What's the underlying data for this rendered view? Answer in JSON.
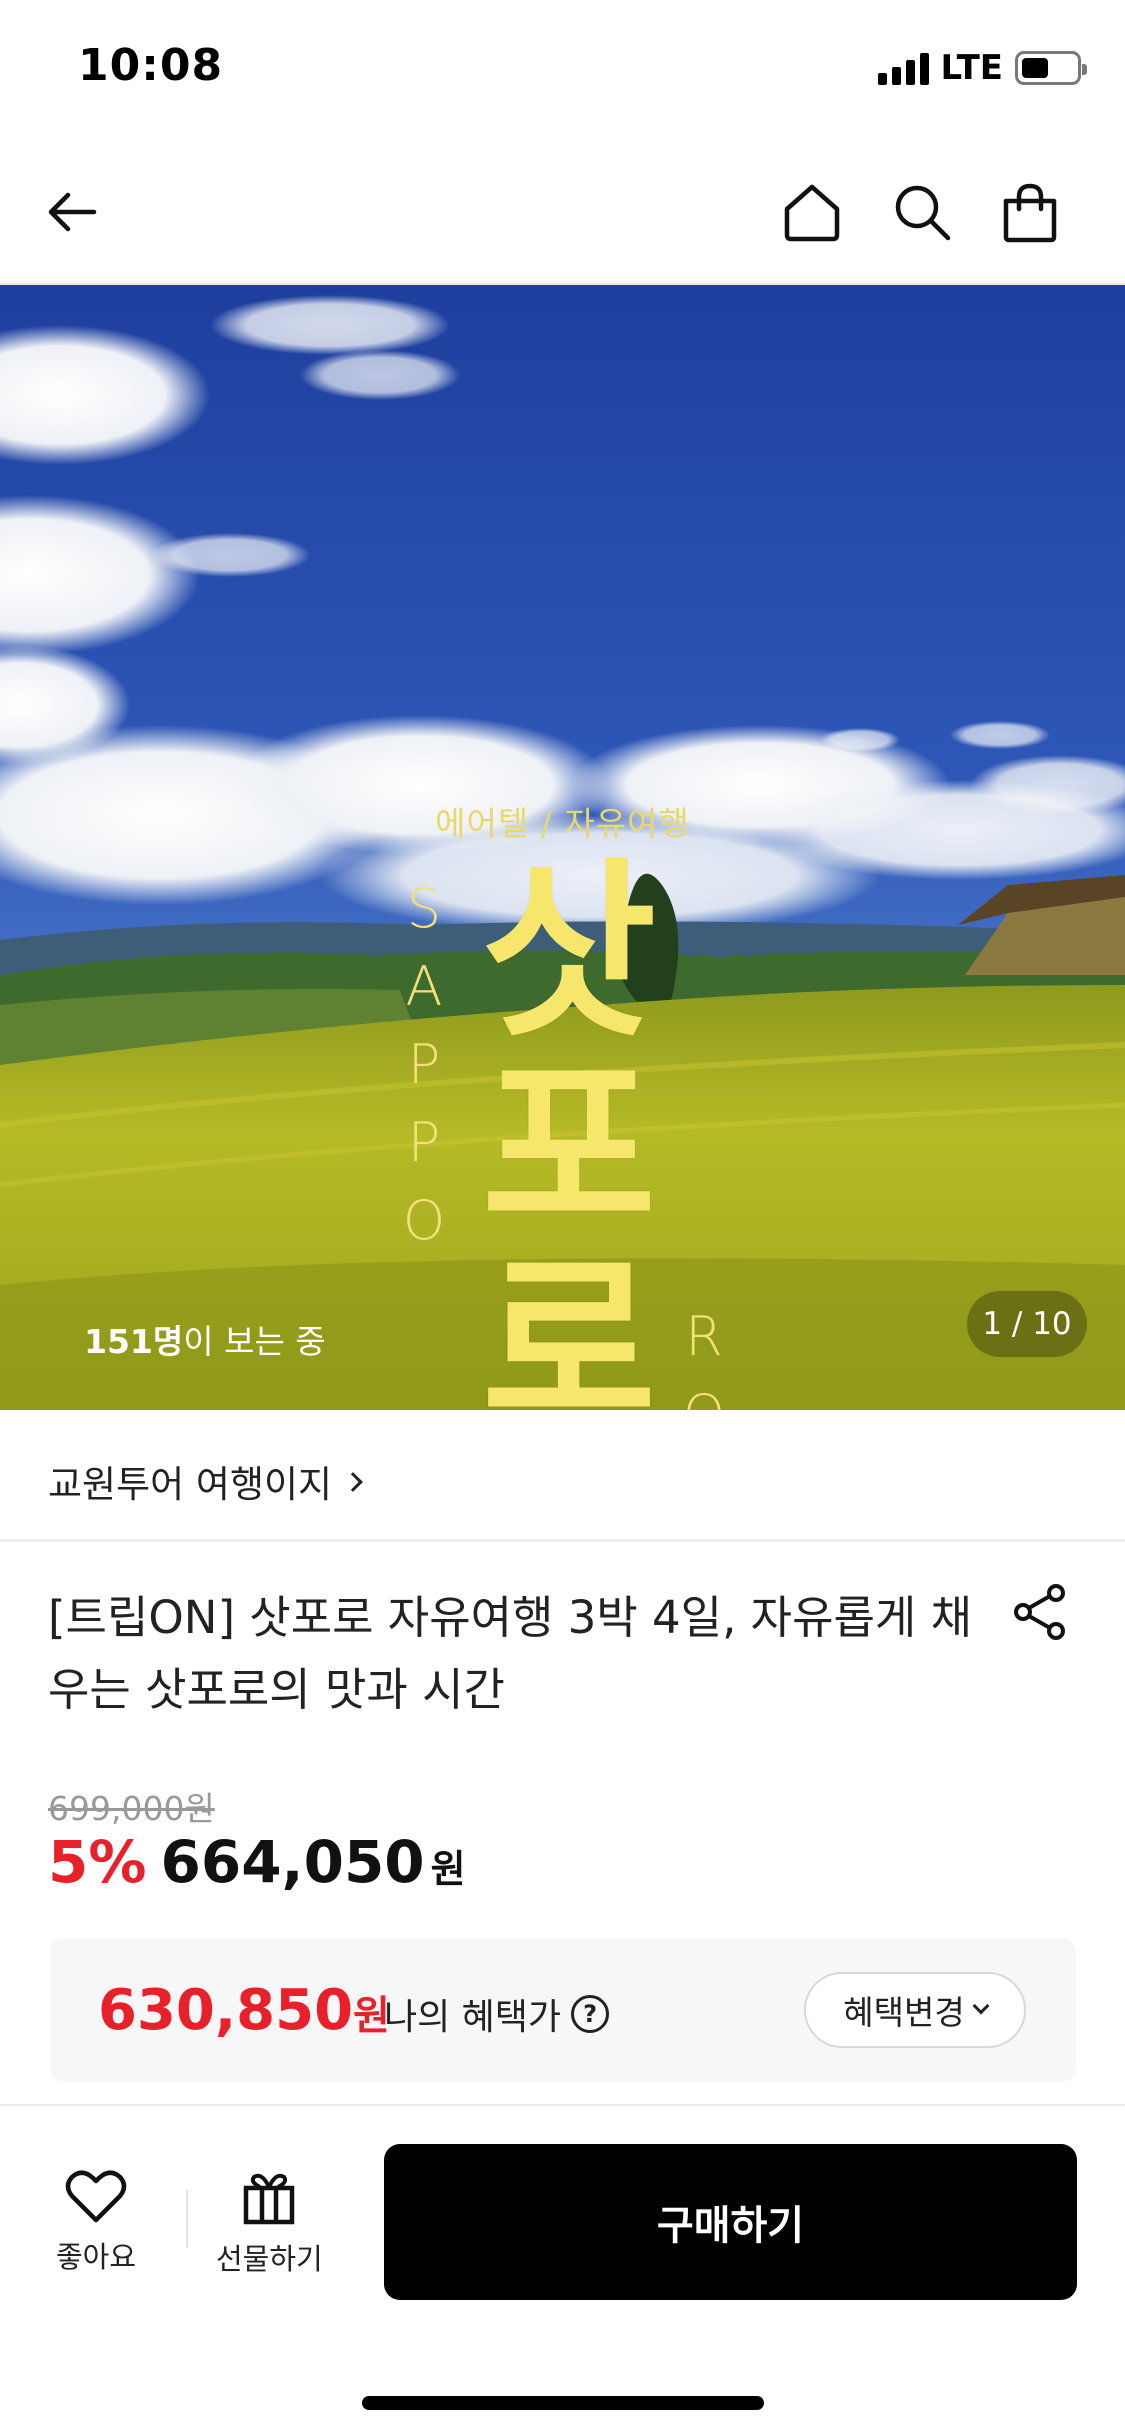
{
  "status_bar": {
    "time": "10:08",
    "network": "LTE"
  },
  "nav": {
    "back_icon": "arrow-left-icon",
    "home_icon": "home-icon",
    "search_icon": "search-icon",
    "cart_icon": "shopping-bag-icon"
  },
  "hero": {
    "subtitle_left": "에어텔 /",
    "subtitle_right": "자유여행",
    "title_chars": [
      "삿",
      "포",
      "로"
    ],
    "latin_left": [
      "S",
      "A",
      "P",
      "P",
      "O"
    ],
    "latin_right": [
      "R",
      "O"
    ],
    "viewer_count": "151명",
    "viewer_suffix": "이 보는 중",
    "page_indicator": "1 / 10"
  },
  "brand": {
    "name": "교원투어 여행이지"
  },
  "product": {
    "title": "[트립ON] 삿포로 자유여행 3박 4일, 자유롭게 채우는 삿포로의 맛과 시간",
    "original_price": "699,000원",
    "discount": "5%",
    "sale_price": "664,050",
    "currency": "원"
  },
  "benefit": {
    "price": "630,850",
    "currency": "원",
    "label": "나의 혜택가",
    "help": "?",
    "change_button": "혜택변경"
  },
  "actions": {
    "like_label": "좋아요",
    "gift_label": "선물하기",
    "buy_label": "구매하기"
  },
  "colors": {
    "accent_red": "#e8202a",
    "hero_title_yellow": "#f6e66b",
    "buy_button": "#000000"
  }
}
